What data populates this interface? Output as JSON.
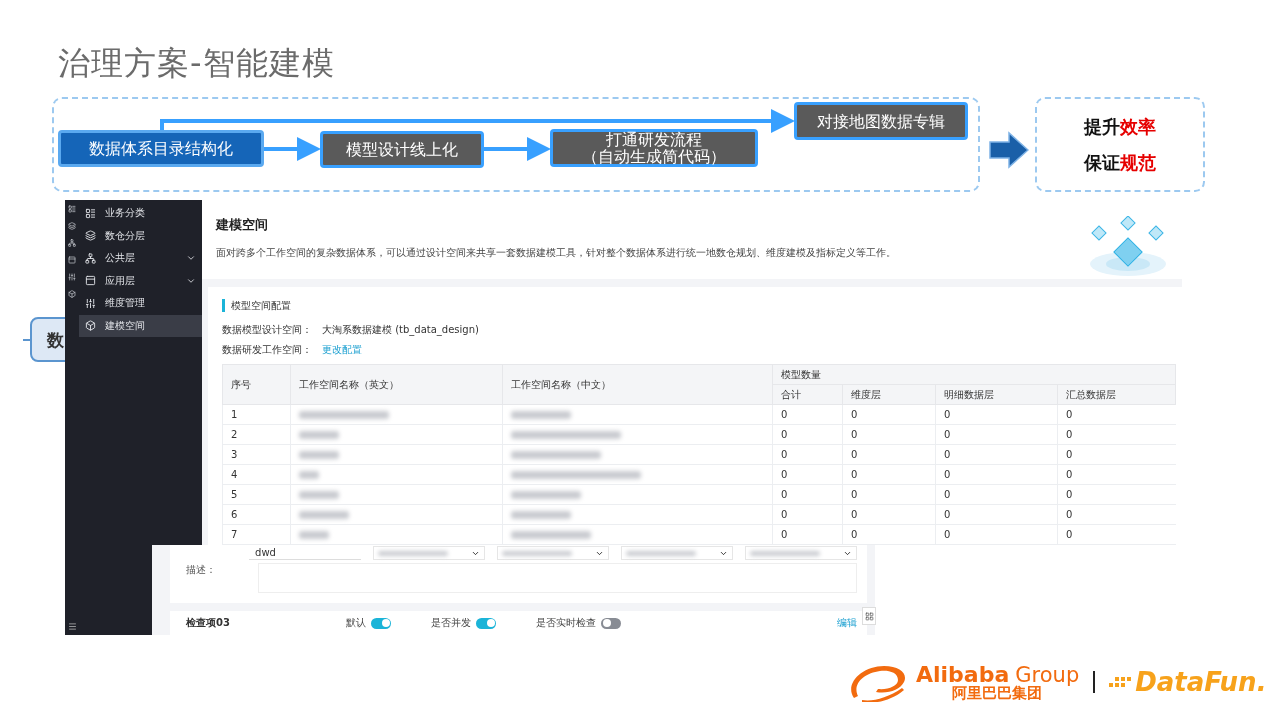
{
  "title": "治理方案-智能建模",
  "flow": {
    "steps": [
      {
        "kind": "primary",
        "lines": [
          "数据体系目录结构化"
        ]
      },
      {
        "kind": "secondary",
        "lines": [
          "模型设计线上化"
        ]
      },
      {
        "kind": "secondary",
        "lines": [
          "打通研发流程",
          "（自动生成简代码）"
        ]
      },
      {
        "kind": "secondary",
        "lines": [
          "对接地图数据专辑"
        ]
      }
    ]
  },
  "outcome": {
    "lines": [
      {
        "text": "提升",
        "highlight": "效率"
      },
      {
        "text": "保证",
        "highlight": "规范"
      }
    ]
  },
  "hidden_node": {
    "label": "数"
  },
  "sidebar": {
    "items": [
      {
        "kind": "classify",
        "label": "业务分类",
        "expandable": false,
        "selected": false
      },
      {
        "kind": "layers",
        "label": "数仓分层",
        "expandable": false,
        "selected": false
      },
      {
        "kind": "network",
        "label": "公共层",
        "expandable": true,
        "selected": false
      },
      {
        "kind": "panel",
        "label": "应用层",
        "expandable": true,
        "selected": false
      },
      {
        "kind": "sliders",
        "label": "维度管理",
        "expandable": false,
        "selected": false
      },
      {
        "kind": "cube",
        "label": "建模空间",
        "expandable": false,
        "selected": true
      }
    ]
  },
  "page": {
    "title": "建模空间",
    "description": "面对跨多个工作空间的复杂数据体系，可以通过设计空间来共享一套数据建模工具，针对整个数据体系进行统一地数仓规划、维度建模及指标定义等工作。"
  },
  "config": {
    "heading": "模型空间配置",
    "fields": [
      {
        "kind": "text",
        "label": "数据模型设计空间：",
        "value": "大淘系数据建模 (tb_data_design)"
      },
      {
        "kind": "link",
        "label": "数据研发工作空间：",
        "value": "更改配置"
      }
    ]
  },
  "table": {
    "columns": [
      "序号",
      "工作空间名称（英文）",
      "工作空间名称（中文）"
    ],
    "group": {
      "label": "模型数量",
      "columns": [
        "合计",
        "维度层",
        "明细数据层",
        "汇总数据层"
      ]
    },
    "rows": [
      {
        "no": "1",
        "counts": [
          "0",
          "0",
          "0",
          "0"
        ]
      },
      {
        "no": "2",
        "counts": [
          "0",
          "0",
          "0",
          "0"
        ]
      },
      {
        "no": "3",
        "counts": [
          "0",
          "0",
          "0",
          "0"
        ]
      },
      {
        "no": "4",
        "counts": [
          "0",
          "0",
          "0",
          "0"
        ]
      },
      {
        "no": "5",
        "counts": [
          "0",
          "0",
          "0",
          "0"
        ]
      },
      {
        "no": "6",
        "counts": [
          "0",
          "0",
          "0",
          "0"
        ]
      },
      {
        "no": "7",
        "counts": [
          "0",
          "0",
          "0",
          "0"
        ]
      }
    ]
  },
  "lower": {
    "value": "dwd",
    "description_label": "描述：",
    "check": {
      "title": "检查项03",
      "toggles": [
        {
          "label": "默认",
          "on": true
        },
        {
          "label": "是否并发",
          "on": true
        },
        {
          "label": "是否实时检查",
          "on": false
        }
      ],
      "actions": [
        "编辑"
      ]
    }
  },
  "footer": {
    "brand": "Alibaba",
    "brand_suffix": "Group",
    "brand_cn": "阿里巴巴集团",
    "partner": "DataFun."
  }
}
